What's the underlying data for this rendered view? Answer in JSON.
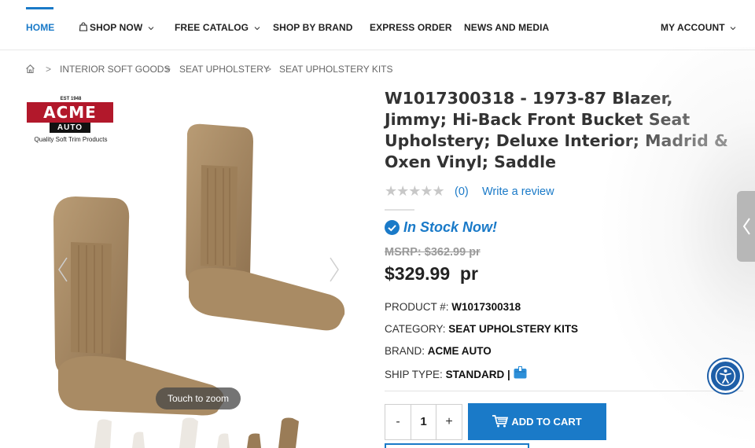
{
  "nav": {
    "items": [
      {
        "label": "HOME",
        "active": true
      },
      {
        "label": "SHOP NOW",
        "has_bag_icon": true,
        "has_caret": true
      },
      {
        "label": "FREE CATALOG",
        "has_caret": true
      },
      {
        "label": "SHOP BY BRAND"
      },
      {
        "label": "EXPRESS ORDER"
      },
      {
        "label": "NEWS AND MEDIA"
      },
      {
        "label": "MY ACCOUNT",
        "has_caret": true
      }
    ],
    "accent_color": "#1a7ac8"
  },
  "breadcrumb": {
    "home_icon": "home-icon",
    "items": [
      "INTERIOR SOFT GOODS",
      "SEAT UPHOLSTERY",
      "SEAT UPHOLSTERY KITS"
    ],
    "separator": ">"
  },
  "gallery": {
    "logo": {
      "est": "EST 1948",
      "name": "ACME",
      "sub": "AUTO",
      "tagline": "Quality Soft Trim Products"
    },
    "zoom_hint": "Touch to zoom",
    "prev_icon": "chevron-left-icon",
    "next_icon": "chevron-right-icon"
  },
  "product": {
    "title": "W1017300318 - 1973-87 Blazer, Jimmy; Hi-Back Front Bucket Seat Upholstery; Deluxe Interior; Madrid & Oxen Vinyl; Saddle",
    "rating_stars": 0,
    "rating_count": "(0)",
    "write_review": "Write a review",
    "stock_status": "In Stock Now!",
    "msrp": "MSRP: $362.99 pr",
    "price": "$329.99",
    "price_unit": "pr",
    "product_number_label": "PRODUCT #:",
    "product_number": "W1017300318",
    "category_label": "CATEGORY:",
    "category": "SEAT UPHOLSTERY KITS",
    "brand_label": "BRAND:",
    "brand": "ACME AUTO",
    "ship_type_label": "SHIP TYPE:",
    "ship_type": "STANDARD |",
    "quantity": "1",
    "minus": "-",
    "plus": "+",
    "add_to_cart": "ADD TO CART"
  },
  "colors": {
    "brand_blue": "#1a7ac8",
    "logo_red": "#b2182b",
    "seat_saddle": "#a88a63"
  }
}
